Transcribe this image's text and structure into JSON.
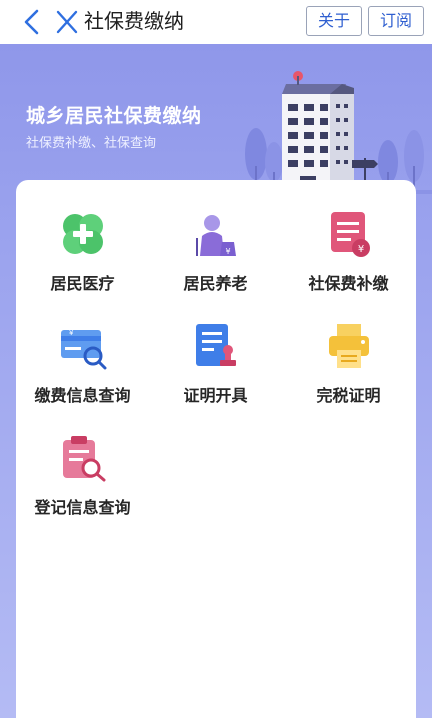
{
  "nav": {
    "title": "社保费缴纳",
    "about_label": "关于",
    "subscribe_label": "订阅"
  },
  "banner": {
    "title": "城乡居民社保费缴纳",
    "subtitle": "社保费补缴、社保查询"
  },
  "services": [
    {
      "label": "居民医疗",
      "icon": "medical-cross-icon"
    },
    {
      "label": "居民养老",
      "icon": "elderly-pension-icon"
    },
    {
      "label": "社保费补缴",
      "icon": "fee-supplement-icon"
    },
    {
      "label": "缴费信息查询",
      "icon": "payment-query-icon"
    },
    {
      "label": "证明开具",
      "icon": "certificate-issue-icon"
    },
    {
      "label": "完税证明",
      "icon": "printer-icon"
    },
    {
      "label": "登记信息查询",
      "icon": "registration-query-icon"
    }
  ],
  "colors": {
    "accent": "#2f5fd0",
    "banner": "#9ba3ee",
    "green": "#4cc36a",
    "purple": "#8a6cd8",
    "pink": "#e0567a",
    "blue": "#3f7ee8",
    "yellow": "#f4c13a"
  }
}
